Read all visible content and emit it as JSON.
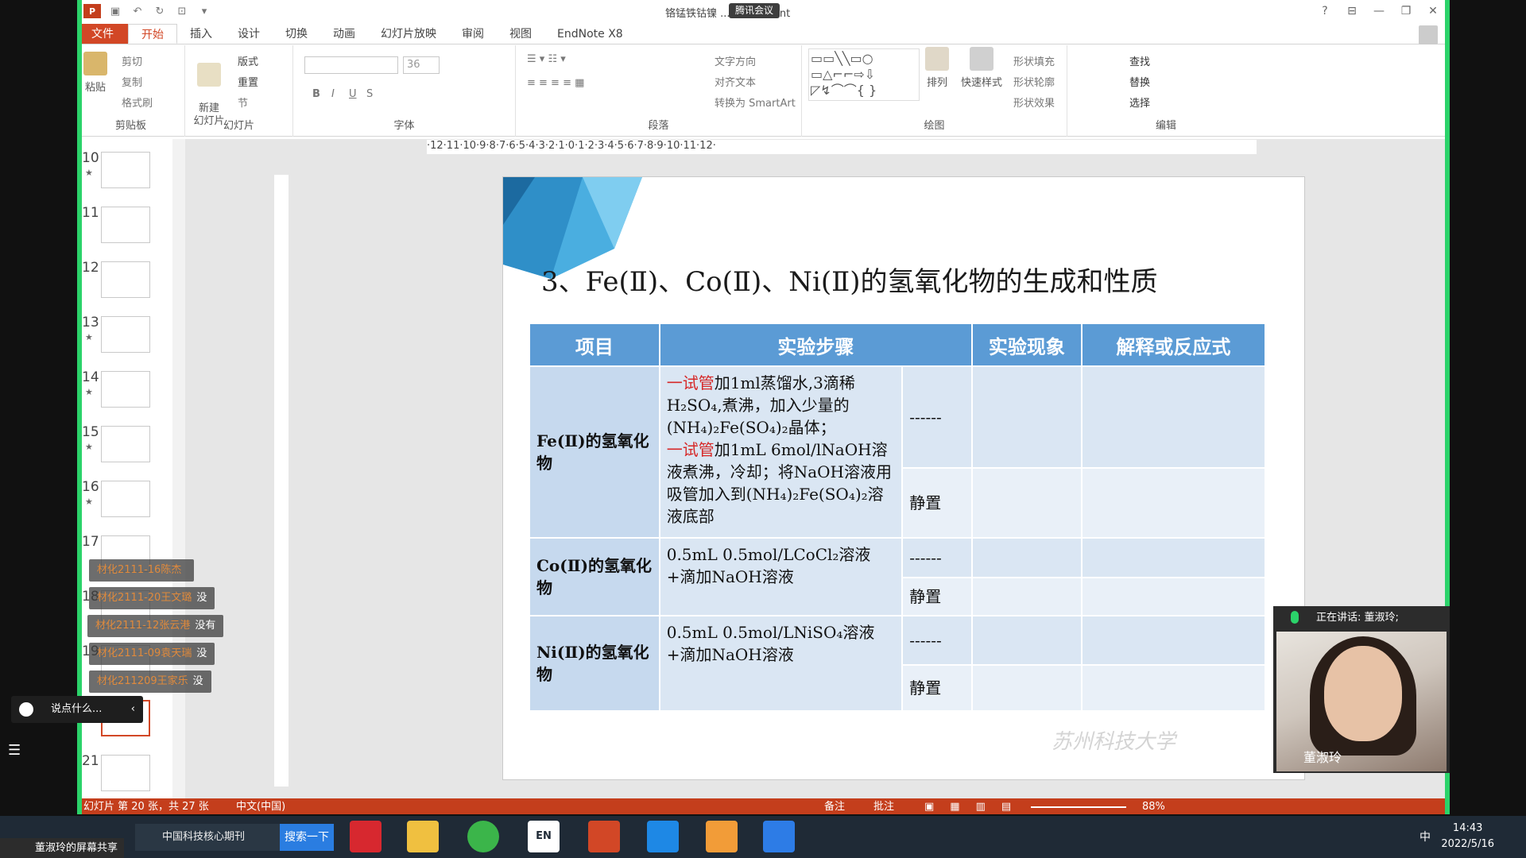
{
  "window": {
    "title": "铬锰铁钴镍 ... PowerPoint",
    "meeting_badge": "腾讯会议",
    "close": "✕",
    "maximize": "❐",
    "minimize": "—",
    "restore": "⊟",
    "help": "?"
  },
  "tabs": [
    "文件",
    "开始",
    "插入",
    "设计",
    "切换",
    "动画",
    "幻灯片放映",
    "审阅",
    "视图",
    "EndNote X8"
  ],
  "ribbon": {
    "clipboard": {
      "paste": "粘贴",
      "cut": "剪切",
      "copy": "复制",
      "format_painter": "格式刷",
      "label": "剪贴板"
    },
    "slides": {
      "new_slide": "新建\n幻灯片",
      "layout": "版式",
      "reset": "重置",
      "section": "节",
      "label": "幻灯片"
    },
    "font": {
      "size": "36",
      "label": "字体"
    },
    "paragraph": {
      "text_direction": "文字方向",
      "align_text": "对齐文本",
      "smartart": "转换为 SmartArt",
      "label": "段落"
    },
    "drawing": {
      "arrange": "排列",
      "quick_styles": "快速样式",
      "shape_fill": "形状填充",
      "shape_outline": "形状轮廓",
      "shape_effects": "形状效果",
      "label": "绘图"
    },
    "editing": {
      "find": "查找",
      "replace": "替换",
      "select": "选择",
      "label": "编辑"
    }
  },
  "thumbnails": [
    {
      "num": "10",
      "star": "★"
    },
    {
      "num": "11",
      "star": ""
    },
    {
      "num": "12",
      "star": ""
    },
    {
      "num": "13",
      "star": "★"
    },
    {
      "num": "14",
      "star": "★"
    },
    {
      "num": "15",
      "star": "★"
    },
    {
      "num": "16",
      "star": "★"
    },
    {
      "num": "17",
      "star": ""
    },
    {
      "num": "18",
      "star": ""
    },
    {
      "num": "19",
      "star": ""
    },
    {
      "num": "2",
      "star": ""
    },
    {
      "num": "21",
      "star": ""
    }
  ],
  "chat": [
    {
      "name": "材化2111-16陈杰",
      "msg": ""
    },
    {
      "name": "材化2111-20王文璐",
      "msg": "没"
    },
    {
      "name": "材化2111-12张云港",
      "msg": "没有"
    },
    {
      "name": "材化2111-09袁天瑞",
      "msg": "没"
    },
    {
      "name": "材化211209王家乐",
      "msg": "没"
    }
  ],
  "say_placeholder": "说点什么...",
  "ruler_h": "·12·11·10·9·8·7·6·5·4·3·2·1·0·1·2·3·4·5·6·7·8·9·10·11·12·",
  "slide": {
    "title": "3、Fe(Ⅱ)、Co(Ⅱ)、Ni(Ⅱ)的氢氧化物的生成和性质",
    "headers": [
      "项目",
      "实验步骤",
      "实验现象",
      "解释或反应式"
    ],
    "rows": {
      "fe_label": "Fe(Ⅱ)的氢氧化物",
      "fe_steps_red1": "一试管",
      "fe_steps_1": "加1ml蒸馏水,3滴稀H₂SO₄,煮沸，加入少量的(NH₄)₂Fe(SO₄)₂晶体；",
      "fe_steps_red2": "一试管",
      "fe_steps_2": "加1mL 6mol/lNaOH溶液煮沸，冷却；将NaOH溶液用吸管加入到(NH₄)₂Fe(SO₄)₂溶液底部",
      "co_label": "Co(Ⅱ)的氢氧化物",
      "co_steps": "0.5mL 0.5mol/LCoCl₂溶液+滴加NaOH溶液",
      "ni_label": "Ni(Ⅱ)的氢氧化物",
      "ni_steps": "0.5mL 0.5mol/LNiSO₄溶液+滴加NaOH溶液",
      "dash": "------",
      "still": "静置"
    },
    "watermark": "苏州科技大学"
  },
  "status": {
    "slide_info": "幻灯片 第 20 张，共 27 张",
    "lang": "中文(中国)",
    "notes": "备注",
    "comments": "批注",
    "zoom": "88%"
  },
  "video": {
    "speaking": "正在讲话: 董淑玲;",
    "name": "董淑玲"
  },
  "taskbar": {
    "search_text": "中国科技核心期刊",
    "search_btn": "搜索一下",
    "time": "14:43",
    "date": "2022/5/16",
    "ime": "中",
    "share": "董淑玲的屏幕共享"
  }
}
